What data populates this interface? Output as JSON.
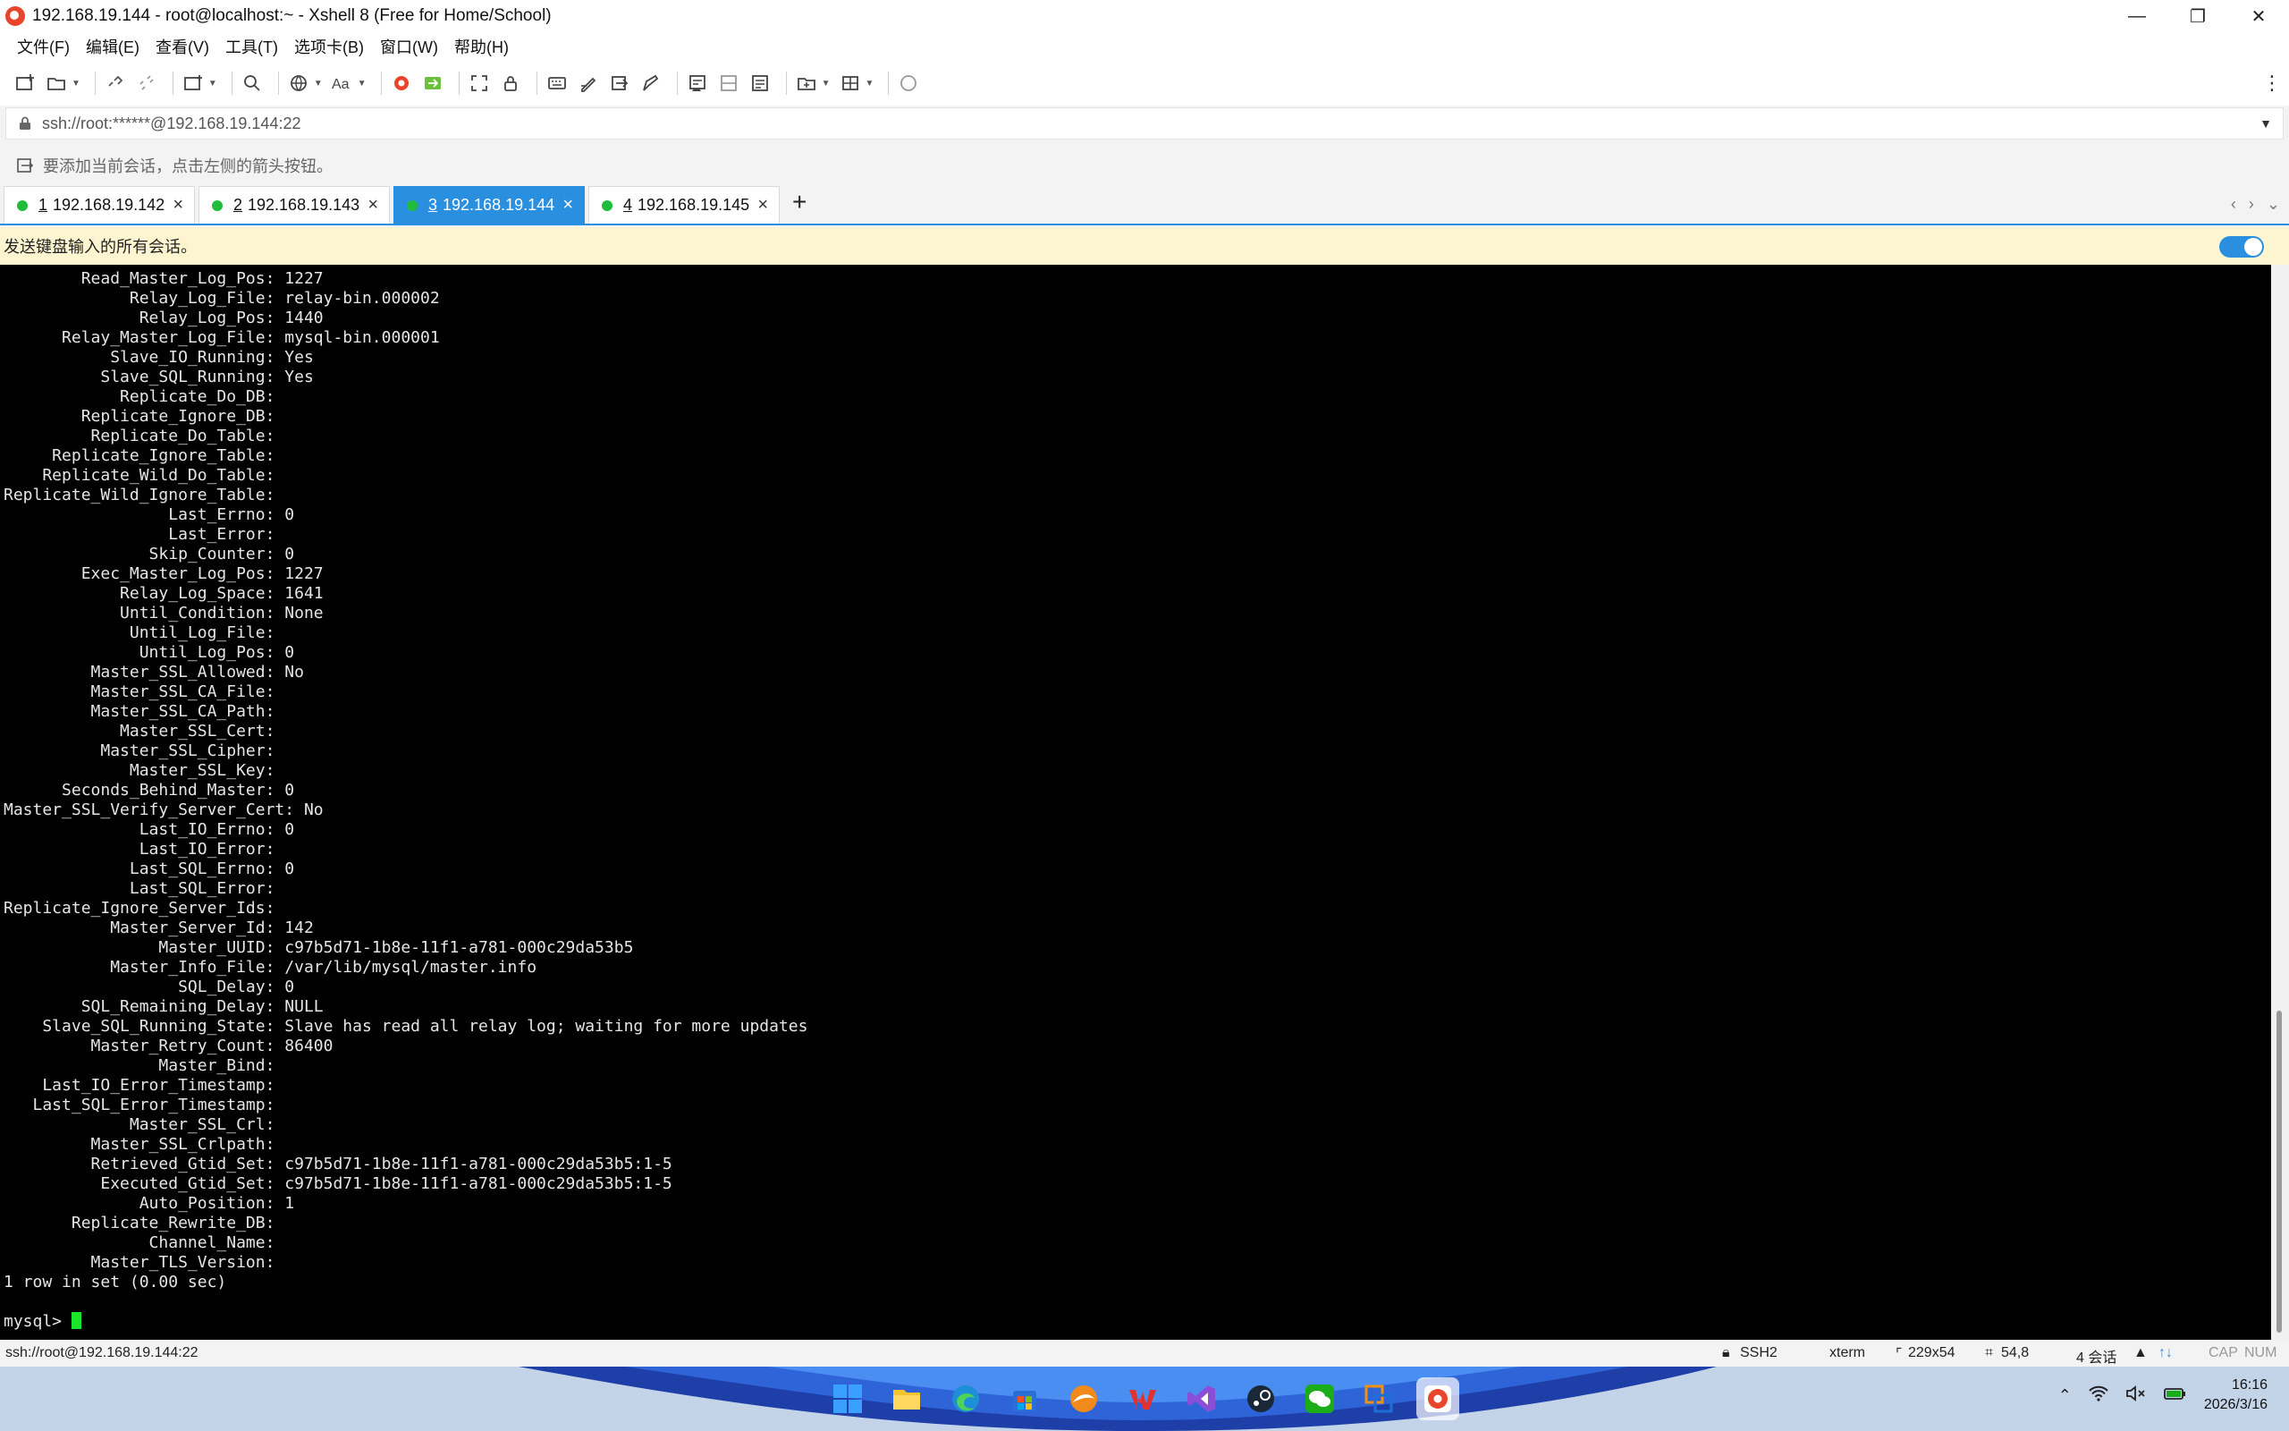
{
  "window": {
    "title": "192.168.19.144 - root@localhost:~ - Xshell 8 (Free for Home/School)",
    "minimize_glyph": "—",
    "restore_glyph": "❐",
    "close_glyph": "✕"
  },
  "menu": [
    "文件(F)",
    "编辑(E)",
    "查看(V)",
    "工具(T)",
    "选项卡(B)",
    "窗口(W)",
    "帮助(H)"
  ],
  "address": {
    "value": "ssh://root:******@192.168.19.144:22"
  },
  "hint": {
    "text": "要添加当前会话，点击左侧的箭头按钮。"
  },
  "tabs": [
    {
      "num": "1",
      "label": "192.168.19.142",
      "status": "connected"
    },
    {
      "num": "2",
      "label": "192.168.19.143",
      "status": "connected"
    },
    {
      "num": "3",
      "label": "192.168.19.144",
      "status": "connected"
    },
    {
      "num": "4",
      "label": "192.168.19.145",
      "status": "connected"
    }
  ],
  "active_tab_index": 2,
  "tab_close_glyph": "×",
  "tab_add_glyph": "+",
  "tab_nav": {
    "left": "‹",
    "right": "›",
    "menu": "⌄"
  },
  "broadcast": {
    "text": "发送键盘输入的所有会话。",
    "enabled": true
  },
  "terminal": {
    "lines": [
      "        Read_Master_Log_Pos: 1227",
      "             Relay_Log_File: relay-bin.000002",
      "              Relay_Log_Pos: 1440",
      "      Relay_Master_Log_File: mysql-bin.000001",
      "           Slave_IO_Running: Yes",
      "          Slave_SQL_Running: Yes",
      "            Replicate_Do_DB: ",
      "        Replicate_Ignore_DB: ",
      "         Replicate_Do_Table: ",
      "     Replicate_Ignore_Table: ",
      "    Replicate_Wild_Do_Table: ",
      "Replicate_Wild_Ignore_Table: ",
      "                 Last_Errno: 0",
      "                 Last_Error: ",
      "               Skip_Counter: 0",
      "        Exec_Master_Log_Pos: 1227",
      "            Relay_Log_Space: 1641",
      "            Until_Condition: None",
      "             Until_Log_File: ",
      "              Until_Log_Pos: 0",
      "         Master_SSL_Allowed: No",
      "         Master_SSL_CA_File: ",
      "         Master_SSL_CA_Path: ",
      "            Master_SSL_Cert: ",
      "          Master_SSL_Cipher: ",
      "             Master_SSL_Key: ",
      "      Seconds_Behind_Master: 0",
      "Master_SSL_Verify_Server_Cert: No",
      "              Last_IO_Errno: 0",
      "              Last_IO_Error: ",
      "             Last_SQL_Errno: 0",
      "             Last_SQL_Error: ",
      "Replicate_Ignore_Server_Ids: ",
      "           Master_Server_Id: 142",
      "                Master_UUID: c97b5d71-1b8e-11f1-a781-000c29da53b5",
      "           Master_Info_File: /var/lib/mysql/master.info",
      "                  SQL_Delay: 0",
      "        SQL_Remaining_Delay: NULL",
      "    Slave_SQL_Running_State: Slave has read all relay log; waiting for more updates",
      "         Master_Retry_Count: 86400",
      "                Master_Bind: ",
      "    Last_IO_Error_Timestamp: ",
      "   Last_SQL_Error_Timestamp: ",
      "             Master_SSL_Crl: ",
      "         Master_SSL_Crlpath: ",
      "         Retrieved_Gtid_Set: c97b5d71-1b8e-11f1-a781-000c29da53b5:1-5",
      "          Executed_Gtid_Set: c97b5d71-1b8e-11f1-a781-000c29da53b5:1-5",
      "              Auto_Position: 1",
      "       Replicate_Rewrite_DB: ",
      "               Channel_Name: ",
      "         Master_TLS_Version: ",
      "1 row in set (0.00 sec)",
      ""
    ],
    "prompt": "mysql> "
  },
  "status": {
    "connection": "ssh://root@192.168.19.144:22",
    "protocol": "SSH2",
    "term_type": "xterm",
    "size": "229x54",
    "cursor_pos": "54,8",
    "sessions": "4 会话",
    "caps": "CAP",
    "num": "NUM"
  },
  "clock": {
    "time": "16:16",
    "date": "2026/3/16"
  },
  "colors": {
    "accent": "#2b8fe0",
    "session_dot": "#1fbd3b",
    "cursor": "#1be52b",
    "broadcast_bg": "#fdf5cf",
    "terminal_bg": "#000000",
    "terminal_fg": "#e6e6e6"
  },
  "icons": {
    "toolbar": [
      "new-session-icon",
      "open-folder-icon",
      "reconnect-icon",
      "disconnect-icon",
      "new-tab-icon",
      "find-icon",
      "globe-icon",
      "font-icon",
      "xshell-icon",
      "xftp-icon",
      "fullscreen-icon",
      "lock-icon",
      "keyboard-icon",
      "script-icon",
      "transfer-icon",
      "compose-icon",
      "log-icon",
      "split-icon",
      "layout-icon",
      "chat-icon"
    ],
    "taskbar": [
      "windows-start-icon",
      "file-explorer-icon",
      "edge-icon",
      "store-icon",
      "browser-icon",
      "wps-icon",
      "visual-studio-icon",
      "steam-icon",
      "wechat-icon",
      "vmware-icon",
      "xshell-icon"
    ]
  }
}
